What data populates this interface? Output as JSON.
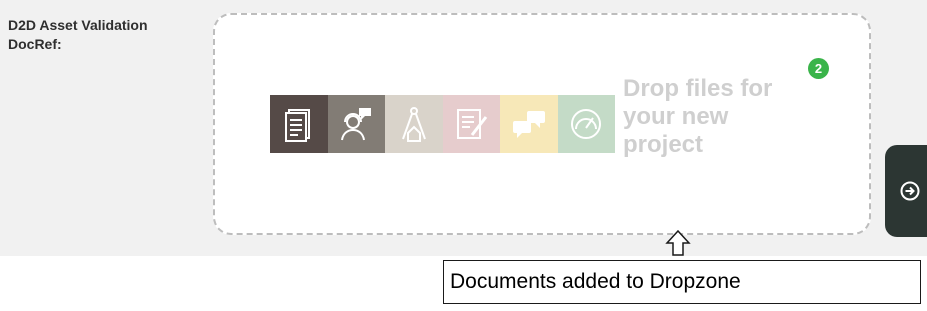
{
  "field": {
    "label_line1": "D2D Asset Validation",
    "label_line2": "DocRef:"
  },
  "dropzone": {
    "badge_count": "2",
    "text_line1": "Drop files for",
    "text_line2": "your new",
    "text_line3": "project",
    "tiles": [
      {
        "icon": "document-icon",
        "color": "#554a47"
      },
      {
        "icon": "support-agent-icon",
        "color": "#827c75"
      },
      {
        "icon": "architecture-icon",
        "color": "#d9d3ca"
      },
      {
        "icon": "contract-icon",
        "color": "#e6cccd"
      },
      {
        "icon": "chat-bubbles-icon",
        "color": "#f7e8b8"
      },
      {
        "icon": "speedometer-icon",
        "color": "#c4dbc7"
      }
    ]
  },
  "side_button": {
    "icon": "arrow-circle-right-icon"
  },
  "annotation": {
    "arrow_icon": "up-arrow-icon",
    "callout_text": "Documents added to Dropzone"
  },
  "colors": {
    "panel_background": "#f1f1f1",
    "badge": "#3ab44a",
    "side_button": "#2c3633",
    "drop_text": "#cfcfcf"
  }
}
